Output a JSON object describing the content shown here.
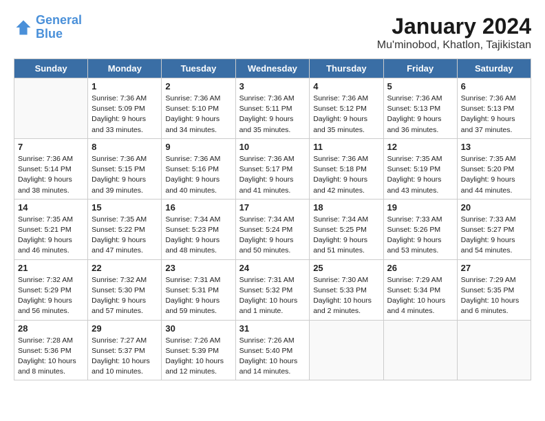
{
  "header": {
    "logo_line1": "General",
    "logo_line2": "Blue",
    "title": "January 2024",
    "subtitle": "Mu'minobod, Khatlon, Tajikistan"
  },
  "calendar": {
    "days_of_week": [
      "Sunday",
      "Monday",
      "Tuesday",
      "Wednesday",
      "Thursday",
      "Friday",
      "Saturday"
    ],
    "weeks": [
      [
        {
          "day": "",
          "text": ""
        },
        {
          "day": "1",
          "text": "Sunrise: 7:36 AM\nSunset: 5:09 PM\nDaylight: 9 hours and 33 minutes."
        },
        {
          "day": "2",
          "text": "Sunrise: 7:36 AM\nSunset: 5:10 PM\nDaylight: 9 hours and 34 minutes."
        },
        {
          "day": "3",
          "text": "Sunrise: 7:36 AM\nSunset: 5:11 PM\nDaylight: 9 hours and 35 minutes."
        },
        {
          "day": "4",
          "text": "Sunrise: 7:36 AM\nSunset: 5:12 PM\nDaylight: 9 hours and 35 minutes."
        },
        {
          "day": "5",
          "text": "Sunrise: 7:36 AM\nSunset: 5:13 PM\nDaylight: 9 hours and 36 minutes."
        },
        {
          "day": "6",
          "text": "Sunrise: 7:36 AM\nSunset: 5:13 PM\nDaylight: 9 hours and 37 minutes."
        }
      ],
      [
        {
          "day": "7",
          "text": "Sunrise: 7:36 AM\nSunset: 5:14 PM\nDaylight: 9 hours and 38 minutes."
        },
        {
          "day": "8",
          "text": "Sunrise: 7:36 AM\nSunset: 5:15 PM\nDaylight: 9 hours and 39 minutes."
        },
        {
          "day": "9",
          "text": "Sunrise: 7:36 AM\nSunset: 5:16 PM\nDaylight: 9 hours and 40 minutes."
        },
        {
          "day": "10",
          "text": "Sunrise: 7:36 AM\nSunset: 5:17 PM\nDaylight: 9 hours and 41 minutes."
        },
        {
          "day": "11",
          "text": "Sunrise: 7:36 AM\nSunset: 5:18 PM\nDaylight: 9 hours and 42 minutes."
        },
        {
          "day": "12",
          "text": "Sunrise: 7:35 AM\nSunset: 5:19 PM\nDaylight: 9 hours and 43 minutes."
        },
        {
          "day": "13",
          "text": "Sunrise: 7:35 AM\nSunset: 5:20 PM\nDaylight: 9 hours and 44 minutes."
        }
      ],
      [
        {
          "day": "14",
          "text": "Sunrise: 7:35 AM\nSunset: 5:21 PM\nDaylight: 9 hours and 46 minutes."
        },
        {
          "day": "15",
          "text": "Sunrise: 7:35 AM\nSunset: 5:22 PM\nDaylight: 9 hours and 47 minutes."
        },
        {
          "day": "16",
          "text": "Sunrise: 7:34 AM\nSunset: 5:23 PM\nDaylight: 9 hours and 48 minutes."
        },
        {
          "day": "17",
          "text": "Sunrise: 7:34 AM\nSunset: 5:24 PM\nDaylight: 9 hours and 50 minutes."
        },
        {
          "day": "18",
          "text": "Sunrise: 7:34 AM\nSunset: 5:25 PM\nDaylight: 9 hours and 51 minutes."
        },
        {
          "day": "19",
          "text": "Sunrise: 7:33 AM\nSunset: 5:26 PM\nDaylight: 9 hours and 53 minutes."
        },
        {
          "day": "20",
          "text": "Sunrise: 7:33 AM\nSunset: 5:27 PM\nDaylight: 9 hours and 54 minutes."
        }
      ],
      [
        {
          "day": "21",
          "text": "Sunrise: 7:32 AM\nSunset: 5:29 PM\nDaylight: 9 hours and 56 minutes."
        },
        {
          "day": "22",
          "text": "Sunrise: 7:32 AM\nSunset: 5:30 PM\nDaylight: 9 hours and 57 minutes."
        },
        {
          "day": "23",
          "text": "Sunrise: 7:31 AM\nSunset: 5:31 PM\nDaylight: 9 hours and 59 minutes."
        },
        {
          "day": "24",
          "text": "Sunrise: 7:31 AM\nSunset: 5:32 PM\nDaylight: 10 hours and 1 minute."
        },
        {
          "day": "25",
          "text": "Sunrise: 7:30 AM\nSunset: 5:33 PM\nDaylight: 10 hours and 2 minutes."
        },
        {
          "day": "26",
          "text": "Sunrise: 7:29 AM\nSunset: 5:34 PM\nDaylight: 10 hours and 4 minutes."
        },
        {
          "day": "27",
          "text": "Sunrise: 7:29 AM\nSunset: 5:35 PM\nDaylight: 10 hours and 6 minutes."
        }
      ],
      [
        {
          "day": "28",
          "text": "Sunrise: 7:28 AM\nSunset: 5:36 PM\nDaylight: 10 hours and 8 minutes."
        },
        {
          "day": "29",
          "text": "Sunrise: 7:27 AM\nSunset: 5:37 PM\nDaylight: 10 hours and 10 minutes."
        },
        {
          "day": "30",
          "text": "Sunrise: 7:26 AM\nSunset: 5:39 PM\nDaylight: 10 hours and 12 minutes."
        },
        {
          "day": "31",
          "text": "Sunrise: 7:26 AM\nSunset: 5:40 PM\nDaylight: 10 hours and 14 minutes."
        },
        {
          "day": "",
          "text": ""
        },
        {
          "day": "",
          "text": ""
        },
        {
          "day": "",
          "text": ""
        }
      ]
    ]
  }
}
